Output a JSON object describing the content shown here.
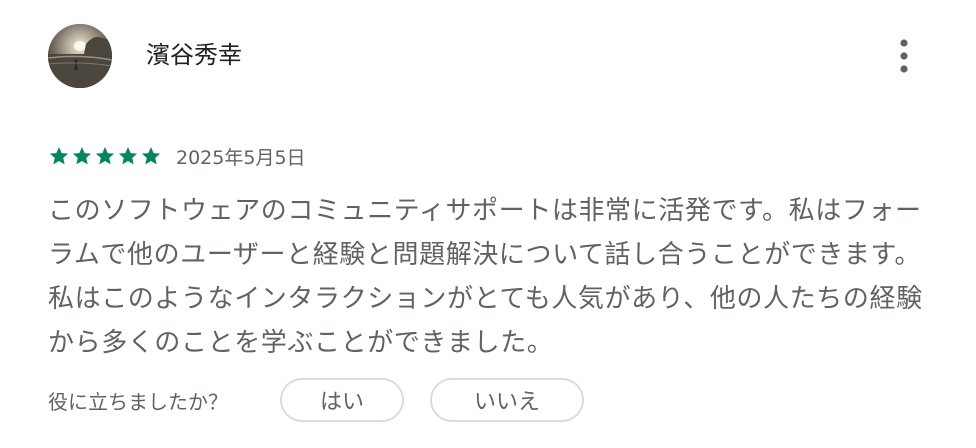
{
  "review": {
    "author_name": "濱谷秀幸",
    "rating": 5,
    "rating_max": 5,
    "date": "2025年5月5日",
    "text": "このソフトウェアのコミュニティサポートは非常に活発です。私はフォーラムで他のユーザーと経験と問題解決について話し合うことができます。私はこのようなインタラクションがとても人気があり、他の人たちの経験から多くのことを学ぶことができました。",
    "star_color": "#01875f",
    "avatar_icon": "avatar-photo",
    "more_icon": "more-vertical-icon"
  },
  "helpful": {
    "question": "役に立ちましたか？",
    "yes_label": "はい",
    "no_label": "いいえ"
  }
}
